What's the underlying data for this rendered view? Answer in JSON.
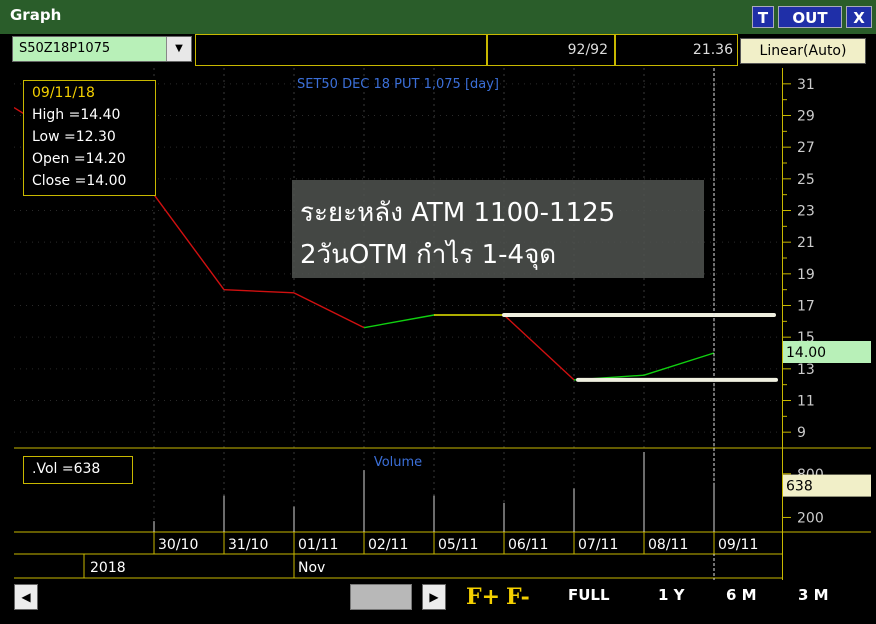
{
  "window": {
    "title": "Graph",
    "buttons": {
      "t": "T",
      "out": "OUT",
      "close": "X"
    }
  },
  "toolbar": {
    "symbol": "S50Z18P1075",
    "count": "92/92",
    "last": "21.36",
    "scale": "Linear(Auto)"
  },
  "chart": {
    "title": "SET50 DEC 18 PUT 1,075 [day]",
    "volume_title": "Volume",
    "current_price": "14.00",
    "current_volume": "638"
  },
  "info": {
    "date": "09/11/18",
    "high": "High  =14.40",
    "low": "Low   =12.30",
    "open": "Open  =14.20",
    "close": "Close  =14.00"
  },
  "vol_label": ".Vol   =638",
  "annotation": {
    "line1": "ระยะหลัง ATM 1100-1125",
    "line2": "2วันOTM กำไร 1-4จุด"
  },
  "price_axis": [
    "31",
    "29",
    "27",
    "25",
    "23",
    "21",
    "19",
    "17",
    "15",
    "13",
    "11",
    "9"
  ],
  "volume_axis": [
    "800",
    "200"
  ],
  "x_labels": [
    "30/10",
    "31/10",
    "01/11",
    "02/11",
    "05/11",
    "06/11",
    "07/11",
    "08/11",
    "09/11"
  ],
  "year_label": "2018",
  "month_label": "Nov",
  "nav": {
    "f_plus": "F+",
    "f_minus": "F-",
    "full": "FULL",
    "y1": "1 Y",
    "m6": "6 M",
    "m3": "3 M"
  },
  "colors": {
    "up": "#10d010",
    "down": "#d01010",
    "grid": "#c8b800",
    "highlight_line": "#f0f0e0"
  },
  "chart_data": {
    "type": "line",
    "x": [
      "29/10",
      "30/10",
      "31/10",
      "01/11",
      "02/11",
      "05/11",
      "06/11",
      "07/11",
      "08/11",
      "09/11"
    ],
    "close": [
      29.5,
      24.0,
      18.0,
      17.8,
      15.6,
      16.4,
      16.4,
      12.3,
      12.6,
      14.0
    ],
    "volume": [
      0,
      150,
      500,
      350,
      850,
      500,
      400,
      600,
      1100,
      638
    ],
    "y_range": [
      8,
      32
    ],
    "volume_range": [
      0,
      1100
    ]
  }
}
